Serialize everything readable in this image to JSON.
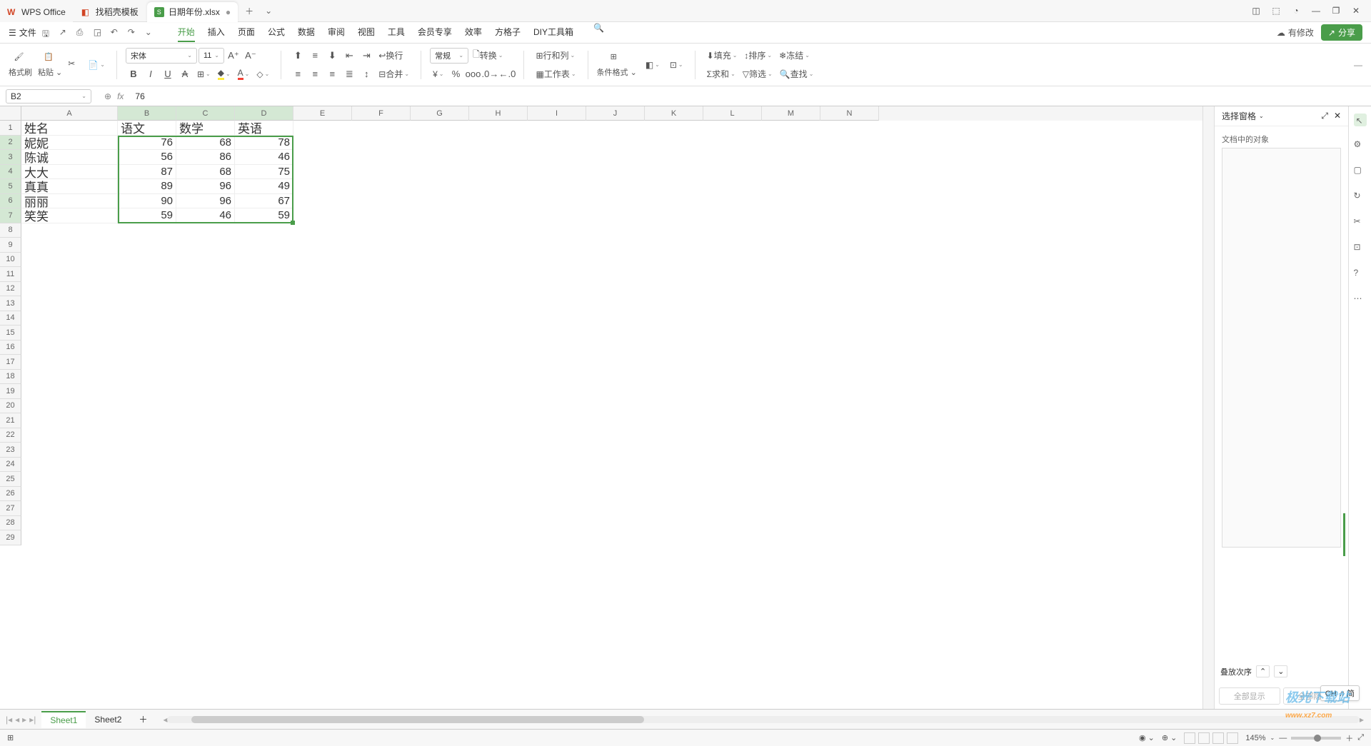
{
  "tabs": {
    "wps": "WPS Office",
    "template": "找稻壳模板",
    "doc": "日期年份.xlsx"
  },
  "menu": {
    "file": "文件",
    "items": [
      "开始",
      "插入",
      "页面",
      "公式",
      "数据",
      "审阅",
      "视图",
      "工具",
      "会员专享",
      "效率",
      "方格子",
      "DIY工具箱"
    ],
    "changes": "有修改",
    "share": "分享"
  },
  "ribbon": {
    "format_painter": "格式刷",
    "paste": "粘贴",
    "font": "宋体",
    "size": "11",
    "wrap": "换行",
    "merge": "合并",
    "number": "常规",
    "convert": "转换",
    "row_col": "行和列",
    "worksheet": "工作表",
    "cond_fmt": "条件格式",
    "fill": "填充",
    "sort": "排序",
    "freeze": "冻结",
    "sum": "求和",
    "filter": "筛选",
    "find": "查找"
  },
  "formula": {
    "cell": "B2",
    "value": "76"
  },
  "columns": [
    "A",
    "B",
    "C",
    "D",
    "E",
    "F",
    "G",
    "H",
    "I",
    "J",
    "K",
    "L",
    "M",
    "N"
  ],
  "rows": 29,
  "data": {
    "headers": [
      "姓名",
      "语文",
      "数学",
      "英语"
    ],
    "rows": [
      [
        "妮妮",
        "76",
        "68",
        "78"
      ],
      [
        "陈诚",
        "56",
        "86",
        "46"
      ],
      [
        "大大",
        "87",
        "68",
        "75"
      ],
      [
        "真真",
        "89",
        "96",
        "49"
      ],
      [
        "丽丽",
        "90",
        "96",
        "67"
      ],
      [
        "笑笑",
        "59",
        "46",
        "59"
      ]
    ]
  },
  "panel": {
    "title": "选择窗格",
    "sub": "文档中的对象",
    "order": "叠放次序",
    "show_all": "全部显示",
    "hide_all": "全部隐藏"
  },
  "sheets": [
    "Sheet1",
    "Sheet2"
  ],
  "status": {
    "zoom": "145%",
    "ime": "CH ♫ 简"
  },
  "footer": {
    "brand": "极光下载站",
    "url": "www.xz7.com"
  }
}
